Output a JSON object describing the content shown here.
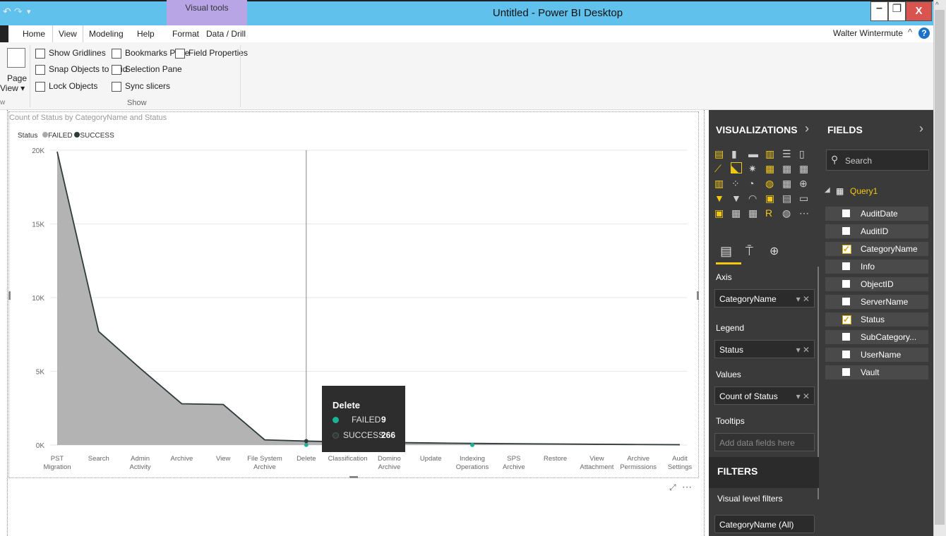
{
  "window": {
    "title": "Untitled - Power BI Desktop",
    "context_tab": "Visual tools",
    "user": "Walter Wintermute"
  },
  "ribbon_tabs": [
    "Home",
    "View",
    "Modeling",
    "Help",
    "Format",
    "Data / Drill"
  ],
  "ribbon": {
    "page_view_label": "Page",
    "page_view_label2": "View ▾",
    "show_group_label": "Show",
    "options": [
      {
        "label": "Show Gridlines",
        "checked": false
      },
      {
        "label": "Snap Objects to Grid",
        "checked": false
      },
      {
        "label": "Lock Objects",
        "checked": false
      },
      {
        "label": "Bookmarks Pane",
        "checked": false
      },
      {
        "label": "Selection Pane",
        "checked": false
      },
      {
        "label": "Sync slicers",
        "checked": false
      },
      {
        "label": "Field Properties",
        "checked": false
      }
    ]
  },
  "visual": {
    "title": "Count of Status by CategoryName and Status",
    "legend_title": "Status",
    "legend": [
      {
        "name": "FAILED",
        "color": "#aaaaaa"
      },
      {
        "name": "SUCCESS",
        "color": "#2f3b3b"
      }
    ]
  },
  "chart_data": {
    "type": "area",
    "title": "Count of Status by CategoryName and Status",
    "ylim": [
      0,
      20000
    ],
    "yticks": [
      "20K",
      "15K",
      "10K",
      "5K",
      "0K"
    ],
    "categories": [
      "PST Migration",
      "Search",
      "Admin Activity",
      "Archive",
      "View",
      "File System Archive",
      "Delete",
      "Classification",
      "Domino Archive",
      "Update",
      "Indexing Operations",
      "SPS Archive",
      "Restore",
      "View Attachment",
      "Archive Permissions",
      "Audit Settings"
    ],
    "series": [
      {
        "name": "SUCCESS",
        "color": "#2f3b3b",
        "values": [
          19900,
          7700,
          5200,
          2800,
          2750,
          350,
          266,
          210,
          170,
          140,
          110,
          90,
          70,
          50,
          35,
          20
        ]
      },
      {
        "name": "FAILED",
        "color": "#1ab394",
        "values": [
          0,
          0,
          0,
          0,
          0,
          0,
          9,
          0,
          0,
          0,
          5,
          0,
          0,
          0,
          0,
          0
        ]
      }
    ],
    "grid": true,
    "legend_position": "top-left",
    "tooltip": {
      "category": "Delete",
      "rows": [
        {
          "name": "FAILED",
          "value": "9"
        },
        {
          "name": "SUCCESS",
          "value": "266"
        }
      ]
    }
  },
  "visualizations_pane": {
    "header": "VISUALIZATIONS",
    "wells": [
      {
        "label": "Axis",
        "value": "CategoryName"
      },
      {
        "label": "Legend",
        "value": "Status"
      },
      {
        "label": "Values",
        "value": "Count of Status"
      },
      {
        "label": "Tooltips",
        "value": "Add data fields here"
      }
    ],
    "filters_header": "FILTERS",
    "visual_level_filters": "Visual level filters",
    "filter_item": "CategoryName (All)"
  },
  "fields_pane": {
    "header": "FIELDS",
    "search_placeholder": "Search",
    "table": "Query1",
    "fields": [
      {
        "name": "AuditDate",
        "checked": false
      },
      {
        "name": "AuditID",
        "checked": false
      },
      {
        "name": "CategoryName",
        "checked": true
      },
      {
        "name": "Info",
        "checked": false
      },
      {
        "name": "ObjectID",
        "checked": false
      },
      {
        "name": "ServerName",
        "checked": false
      },
      {
        "name": "Status",
        "checked": true
      },
      {
        "name": "SubCategory...",
        "checked": false
      },
      {
        "name": "UserName",
        "checked": false
      },
      {
        "name": "Vault",
        "checked": false
      }
    ]
  }
}
